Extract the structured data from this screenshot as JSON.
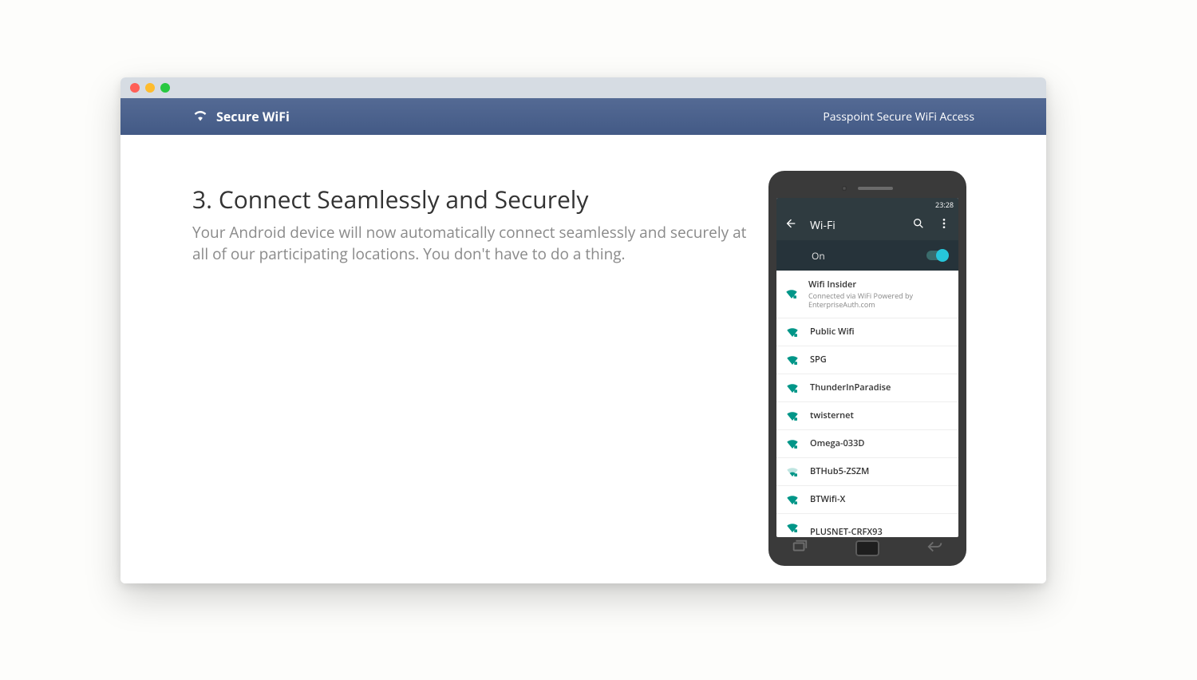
{
  "topbar": {
    "brand": "Secure WiFi",
    "right": "Passpoint Secure WiFi Access"
  },
  "heading": "3. Connect Seamlessly and Securely",
  "subheading": "Your Android device will now automatically connect seamlessly and securely at all of our participating locations. You don't have to do a thing.",
  "phone": {
    "clock": "23:28",
    "header_title": "Wi-Fi",
    "toggle_label": "On",
    "networks": [
      {
        "name": "Wifi Insider",
        "sub": "Connected via WiFi Powered by EnterpriseAuth.com",
        "strength": "full"
      },
      {
        "name": "Public Wifi",
        "strength": "full"
      },
      {
        "name": "SPG",
        "strength": "full"
      },
      {
        "name": "ThunderInParadise",
        "strength": "full"
      },
      {
        "name": "twisternet",
        "strength": "full"
      },
      {
        "name": "Omega-033D",
        "strength": "full"
      },
      {
        "name": "BTHub5-ZSZM",
        "strength": "weak"
      },
      {
        "name": "BTWifi-X",
        "strength": "full"
      },
      {
        "name": "PLUSNET-CRFX93",
        "strength": "full",
        "clipped": true
      }
    ]
  }
}
